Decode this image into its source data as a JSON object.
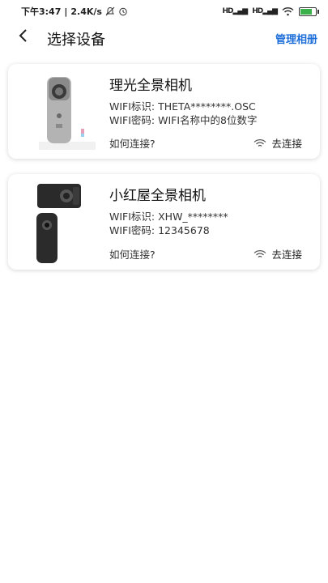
{
  "status_bar": {
    "time": "下午3:47",
    "speed": "2.4K/s",
    "signal1": "HD",
    "signal2": "HD",
    "battery_level": 0.85,
    "battery_color": "#3ab14a"
  },
  "header": {
    "back_icon": "chevron-left-icon",
    "title": "选择设备",
    "manage_label": "管理相册"
  },
  "devices": [
    {
      "name": "理光全景相机",
      "wifi_id": "WIFI标识: THETA********.OSC",
      "wifi_password": "WIFI密码: WIFI名称中的8位数字",
      "how_label": "如何连接?",
      "connect_label": "去连接"
    },
    {
      "name": "小红屋全景相机",
      "wifi_id": "WIFI标识: XHW_********",
      "wifi_password": "WIFI密码: 12345678",
      "how_label": "如何连接?",
      "connect_label": "去连接"
    }
  ],
  "colors": {
    "accent": "#1e6fd9"
  }
}
